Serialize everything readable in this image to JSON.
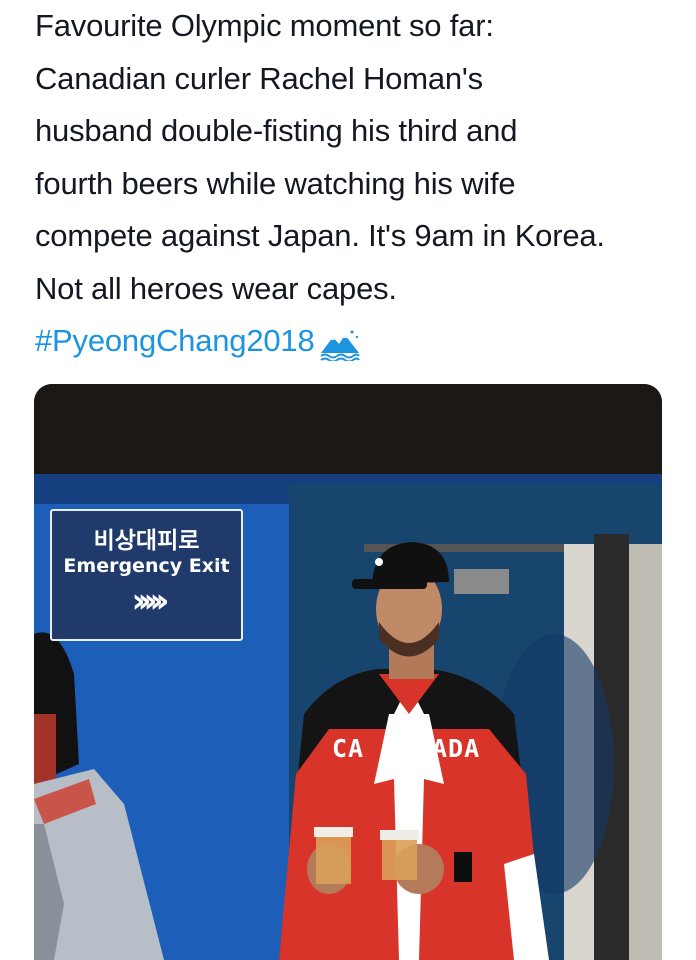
{
  "tweet": {
    "lines": [
      "Favourite Olympic moment so far:",
      "Canadian curler Rachel Homan's",
      "husband double-fisting his third and",
      "fourth beers while watching his wife",
      "compete against Japan. It's 9am in Korea.",
      "Not all heroes wear capes."
    ],
    "hashtag": "#PyeongChang2018",
    "hashtag_icon": "pyeongchang-mountain-emoji-icon",
    "hashtag_color": "#1c94e0"
  },
  "photo": {
    "sign": {
      "korean": "비상대피로",
      "english": "Emergency Exit",
      "arrows": "›››››"
    },
    "jacket": {
      "left_text": "CA",
      "right_text": "ADA"
    }
  }
}
